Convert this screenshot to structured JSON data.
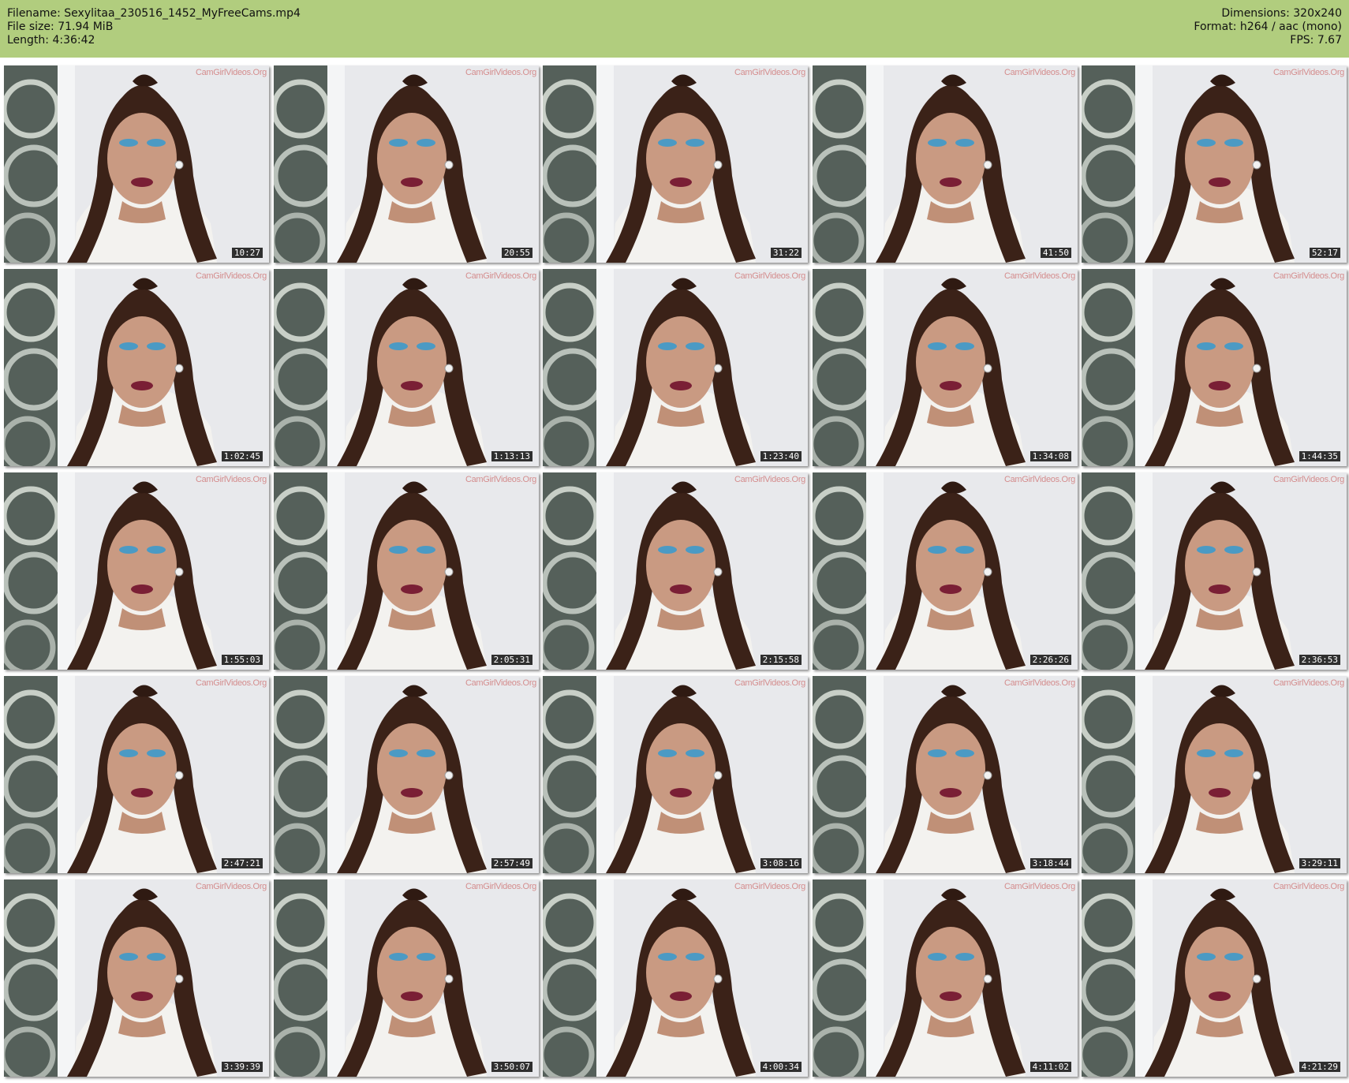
{
  "header": {
    "filename": "Filename: Sexylitaa_230516_1452_MyFreeCams.mp4",
    "file_size": "File size: 71.94 MiB",
    "length": "Length: 4:36:42",
    "dimensions": "Dimensions: 320x240",
    "format": "Format: h264 / aac (mono)",
    "fps": "FPS: 7.67"
  },
  "colors": {
    "header_bg": "#b1cd7e",
    "timestamp_bg": "#2f2f2f"
  },
  "thumbnails": [
    {
      "time": "10:27",
      "watermark": "CamGirlVideos.Org"
    },
    {
      "time": "20:55",
      "watermark": "CamGirlVideos.Org"
    },
    {
      "time": "31:22",
      "watermark": "CamGirlVideos.Org"
    },
    {
      "time": "41:50",
      "watermark": "CamGirlVideos.Org"
    },
    {
      "time": "52:17",
      "watermark": "CamGirlVideos.Org"
    },
    {
      "time": "1:02:45",
      "watermark": "CamGirlVideos.Org"
    },
    {
      "time": "1:13:13",
      "watermark": "CamGirlVideos.Org"
    },
    {
      "time": "1:23:40",
      "watermark": "CamGirlVideos.Org"
    },
    {
      "time": "1:34:08",
      "watermark": "CamGirlVideos.Org"
    },
    {
      "time": "1:44:35",
      "watermark": "CamGirlVideos.Org"
    },
    {
      "time": "1:55:03",
      "watermark": "CamGirlVideos.Org"
    },
    {
      "time": "2:05:31",
      "watermark": "CamGirlVideos.Org"
    },
    {
      "time": "2:15:58",
      "watermark": "CamGirlVideos.Org"
    },
    {
      "time": "2:26:26",
      "watermark": "CamGirlVideos.Org"
    },
    {
      "time": "2:36:53",
      "watermark": "CamGirlVideos.Org"
    },
    {
      "time": "2:47:21",
      "watermark": "CamGirlVideos.Org"
    },
    {
      "time": "2:57:49",
      "watermark": "CamGirlVideos.Org"
    },
    {
      "time": "3:08:16",
      "watermark": "CamGirlVideos.Org"
    },
    {
      "time": "3:18:44",
      "watermark": "CamGirlVideos.Org"
    },
    {
      "time": "3:29:11",
      "watermark": "CamGirlVideos.Org"
    },
    {
      "time": "3:39:39",
      "watermark": "CamGirlVideos.Org"
    },
    {
      "time": "3:50:07",
      "watermark": "CamGirlVideos.Org"
    },
    {
      "time": "4:00:34",
      "watermark": "CamGirlVideos.Org"
    },
    {
      "time": "4:11:02",
      "watermark": "CamGirlVideos.Org"
    },
    {
      "time": "4:21:29",
      "watermark": "CamGirlVideos.Org"
    }
  ]
}
